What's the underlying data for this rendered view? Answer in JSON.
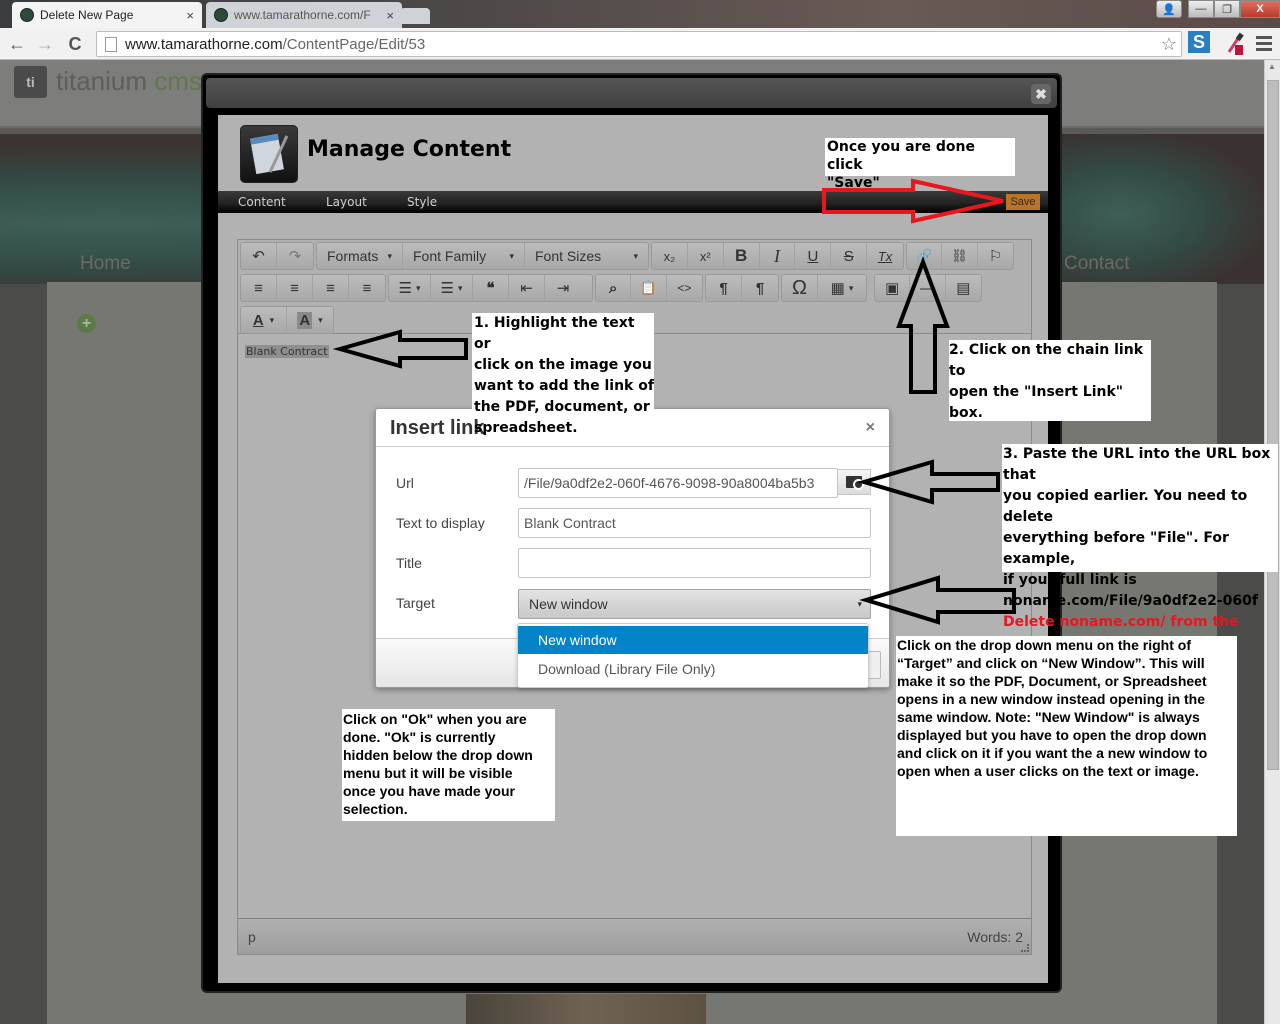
{
  "browser": {
    "tabs": [
      {
        "title": "Delete New Page",
        "active": true
      },
      {
        "title": "www.tamarathorne.com/F",
        "active": false
      }
    ],
    "address": {
      "host": "www.tamarathorne.com",
      "path": "/ContentPage/Edit/53"
    },
    "icons": {
      "back": "←",
      "forward": "→",
      "reload": "C",
      "star": "☆",
      "ext_s": "S",
      "minimize": "—",
      "restore": "❐",
      "close": "X",
      "user": "👤",
      "tab_close": "×"
    }
  },
  "site": {
    "logo_mark": "ti",
    "logo_text_main": "titanium ",
    "logo_text_accent": "cms",
    "nav": {
      "home": "Home",
      "contact": "Contact"
    },
    "add_icon": "+"
  },
  "manage_content": {
    "title": "Manage Content",
    "close_icon": "✖",
    "tabs": [
      "Content",
      "Layout",
      "Style"
    ],
    "save_label": "Save"
  },
  "editor": {
    "toolbar": {
      "undo": "↶",
      "redo": "↷",
      "formats": "Formats",
      "font_family": "Font Family",
      "font_sizes": "Font Sizes",
      "subscript": "x₂",
      "superscript": "x²",
      "bold": "B",
      "italic": "I",
      "underline": "U",
      "strikethrough": "S",
      "clear_format": "Tx",
      "link": "🔗",
      "unlink": "⛓",
      "anchor": "⚐",
      "align_left": "≡",
      "align_center": "≡",
      "align_right": "≡",
      "justify": "≡",
      "bullet_list": "☰",
      "numbered_list": "☰",
      "blockquote": "❝",
      "outdent": "⇤",
      "indent": "⇥",
      "find": "⌕",
      "paste_text": "📋",
      "code": "<>",
      "ltr": "¶",
      "rtl": "¶",
      "charmap": "Ω",
      "table": "▦",
      "image": "▣",
      "hr": "—",
      "template": "▤",
      "text_color": "A",
      "bg_color": "A",
      "caret": "▾"
    },
    "content_text": "Blank Contract",
    "status_path": "p",
    "word_count": "Words: 2"
  },
  "insert_link": {
    "title": "Insert link",
    "close_icon": "×",
    "fields": {
      "url_label": "Url",
      "url_value": "/File/9a0df2e2-060f-4676-9098-90a8004ba5b3",
      "text_label": "Text to display",
      "text_value": "Blank Contract",
      "title_label": "Title",
      "title_value": "",
      "target_label": "Target",
      "target_value": "New window"
    },
    "target_options": [
      "New window",
      "Download (Library File Only)"
    ],
    "selected_option": "New window",
    "selected_color": "#0384c8"
  },
  "annotations": {
    "save": "Once you are done click\n\"Save\"",
    "step1": "1. Highlight the text or\nclick on the image you\nwant to add the link of\nthe PDF, document, or\nspreadsheet.",
    "step2": "2. Click on the chain link to\nopen the \"Insert Link\" box.",
    "step3": "3. Paste the URL into the URL box that\nyou copied earlier. You need to delete\neverything before \"File\". For example,\nif your full link is\nnoname.com/File/9a0df2e2-060f",
    "step3_warning": "Delete noname.com/ from the URL.",
    "target": "Click on the drop down menu on the right of\n“Target” and click on “New Window”.  This will\nmake it so the PDF, Document, or Spreadsheet\nopens in a new window instead opening in the\nsame window. Note: \"New Window\" is always\ndisplayed but you have to open the drop down\nand click on it if you want the a new window to\nopen when a user clicks on the text or image.",
    "ok": "Click on \"Ok\" when you are\ndone. \"Ok\" is currently\nhidden below the drop down\nmenu but it will be visible\nonce you have made your\nselection.",
    "arrow_colors": {
      "save_arrow": "#e8161e",
      "other_arrows": "#000000"
    }
  }
}
